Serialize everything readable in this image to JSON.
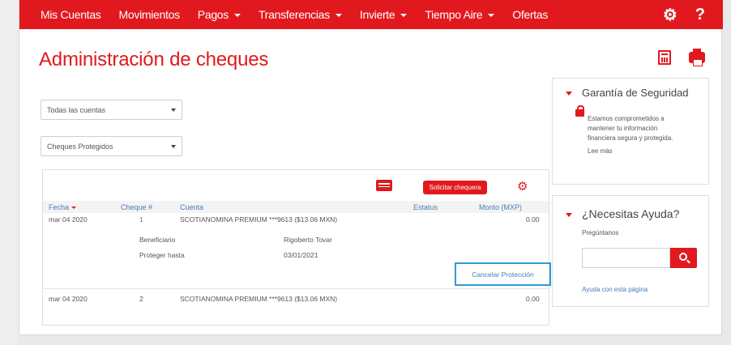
{
  "nav": {
    "items": [
      {
        "label": "Mis Cuentas",
        "has_menu": false
      },
      {
        "label": "Movimientos",
        "has_menu": false
      },
      {
        "label": "Pagos",
        "has_menu": true
      },
      {
        "label": "Transferencias",
        "has_menu": true
      },
      {
        "label": "Invierte",
        "has_menu": true
      },
      {
        "label": "Tiempo Aire",
        "has_menu": true
      },
      {
        "label": "Ofertas",
        "has_menu": false
      }
    ],
    "help_label": "?"
  },
  "page": {
    "title": "Administración de cheques"
  },
  "filters": {
    "account_value": "Todas las cuentas",
    "type_value": "Cheques Protegidos"
  },
  "panel": {
    "request_button": "Solicitar chequera"
  },
  "table": {
    "headers": [
      "Fecha",
      "Cheque #",
      "Cuenta",
      "Estatus",
      "Monto (MXP)"
    ],
    "rows": [
      {
        "fecha": "mar 04 2020",
        "cheque": "1",
        "cuenta": "SCOTIANOMINA PREMIUM ***9613 ($13.06 MXN)",
        "estatus": "",
        "monto": "0.00",
        "details": [
          {
            "label": "Beneficiario",
            "value": "Rigoberto Tovar"
          },
          {
            "label": "Proteger hasta",
            "value": "03/01/2021"
          }
        ],
        "action": "Cancelar Protección"
      },
      {
        "fecha": "mar 04 2020",
        "cheque": "2",
        "cuenta": "SCOTIANOMINA PREMIUM ***9613 ($13.06 MXN)",
        "estatus": "",
        "monto": "0.00"
      }
    ]
  },
  "security": {
    "title": "Garantía de Seguridad",
    "text_lines": [
      "Estamos comprometidos a",
      "mantener tu información",
      "financiera segura y protegida."
    ],
    "link": "Lee más"
  },
  "help": {
    "title": "¿Necesitas Ayuda?",
    "label": "Pregúntanos",
    "input_value": "",
    "link": "Ayuda con esta página"
  },
  "colors": {
    "brand_red": "#e1191e",
    "link_blue": "#4a7bb7",
    "focus_blue": "#2f9bd2"
  }
}
